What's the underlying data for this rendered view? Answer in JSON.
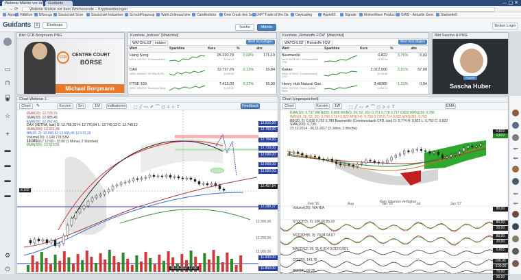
{
  "browser": {
    "tabs": [
      "Webinar Märkte vor dem Wochenende",
      "Guidants"
    ],
    "url": "Webinar Märkte vor dem Wochenende – Kryptowährungen",
    "bookmarks": [
      "Apps",
      "HdbRun",
      "Elfzeugs",
      "Stockchart Scan",
      "Stockchart Industries",
      "SchrottFlopzeug",
      "Wahl-Zeitmaschine",
      "Candlesticks",
      "Dow Crash des Jahrh",
      "24/7 Trade of the Da",
      "Daytrading",
      "Apple60",
      "Signale",
      "MotiveWave Product",
      "GWG - Aktuelle Gesc",
      "Startseite0"
    ]
  },
  "header": {
    "logo": "Guidants",
    "desktop_button": "Desktops",
    "search_button": "Suche",
    "news_button": "Märkte",
    "right_button": "Broker Login"
  },
  "panels": {
    "img1": {
      "title": "Bild CCB Borgmann PNG",
      "logo_line1": "CENTRE COURT",
      "logo_line2": "BÖRSE",
      "logo_abbr": "CCB",
      "person_name": "Michael Borgmann"
    },
    "wl1": {
      "title": "Kursliste „Indizes“ [Watchlist]",
      "tab": "WATCHLIST",
      "tab2": "Indizes",
      "add_button": "Wert hinzufügen",
      "headers": [
        "Wert",
        "Sparkline",
        "Kurs",
        "%",
        "abs"
      ],
      "rows": [
        {
          "name": "Hang Seng",
          "sub": "WKN: 145733 / Commerzbank I",
          "kurs": "25.220,79",
          "pct": "0,68%",
          "abs": "171,10",
          "time": "14:56:13"
        },
        {
          "name": "DAX",
          "sub": "WKN: 846900 / XETRA (EXP)",
          "kurs": "12.727,76",
          "pct": "0,13%",
          "abs": "16,84",
          "time": "14:56:03"
        },
        {
          "name": "FTSE 100",
          "sub": "WKN: 969378 / Deutsche Bank I",
          "kurs": "7.413,00",
          "pct": "0,22%",
          "abs": "16,00",
          "time": "14:55:59"
        }
      ]
    },
    "wl2": {
      "title": "Kursliste „Rohstoffe FCM“ [Watchlist]",
      "tab": "WATCHLIST",
      "tab2": "Rohstoffe FCM",
      "add_button": "Wert hinzufügen",
      "headers": [
        "Wert",
        "Sparkline",
        "Kurs",
        "%",
        "abs"
      ],
      "rows": [
        {
          "name": "Baumwolle",
          "sub": "WKN: A0AEZN / Commerzbank CFD",
          "kurs": "0,822",
          "pct": "3,76%",
          "abs": "0,03",
          "time": "14:56:06"
        },
        {
          "name": "Kakao",
          "sub": "WKN: 970991 / Commerzbank CFD",
          "kurs": "2.012,000",
          "pct": "2,91%",
          "abs": "57,00",
          "time": "14:56:08"
        },
        {
          "name": "Henry Hub Natural Gas",
          "sub": "WKN: 437108 / Forex Capital Mark.",
          "kurs": "3,48360",
          "pct": "1,31%",
          "abs": "0,04",
          "time": "14:56:11"
        }
      ]
    },
    "img2": {
      "title": "Bild Sascha H PNG",
      "badge": "Experte",
      "person_name": "Sascha Huber"
    }
  },
  "chart1": {
    "title": "Chart Webinar 1",
    "toolbar": [
      "Chart",
      "Kerzen",
      "5m",
      "1M",
      "Indikatoren"
    ],
    "feedback_button": "Feedback",
    "legend": [
      {
        "text": "EMA(10): 12.729,76",
        "color": "#d03a3a"
      },
      {
        "text": "SMA(20): 12.685,45",
        "color": "#333333"
      },
      {
        "text": "EMA(20): 12.252,43",
        "color": "#3a6ad0"
      },
      {
        "text": "DAX (XETRA, last)  O: 12.766,32  H: 12.770,94  L: 12.749,12  C: 12.749,12",
        "color": "#111111"
      },
      {
        "text": "SMA(200): 12.221,99",
        "color": "#a03a3a"
      },
      {
        "text": "BB(20, 2): 12.800,62  12.685,45  12.570,28",
        "color": "#3a6ad0"
      },
      {
        "text": "Volume(20): 1.140   778.53M",
        "color": "#333333"
      },
      {
        "text": "13.04.2017  17:00 - 15:00  (1 Monat, 2 Stunden)",
        "color": "#333333"
      },
      {
        "text": "EMA(200): 12.513,56",
        "color": "#3a8a3a"
      }
    ],
    "price_labels": [
      "12.810,00",
      "12.793,00",
      "12.764,00",
      "12.720,00",
      "12.690,00",
      "12.600,00",
      "12.550,00",
      "12.457,84",
      "12.289,37",
      "11.935,00",
      "11.850,00"
    ],
    "axis_labels": [
      "12.300,00",
      "12.250,00",
      "12.000,00"
    ],
    "left_label": "8.160",
    "mid_label": "10.000",
    "date_label": "08.05.2017 17:00"
  },
  "chart2": {
    "title": "Chart [ungespeichert]",
    "toolbar": [
      "Chart",
      "Kerzen",
      "1W",
      "EMA"
    ],
    "legend": [
      {
        "text": "EMA(10): 0,737   WKN(20): 0,808   WKN(9, 26, 52, 26): 0,751  0,778  0,717  0,822  WKN(20): 0,780",
        "color": "#2a8a2a"
      },
      {
        "text": "WKN(9, 26, 52, 26): 0,798  0,714  0,822   ATR(14): 0,750  0,778  0,714  0,822   WKN(20): 0,762",
        "color": "#c07a20"
      },
      {
        "text": "BB(20, 2): 0,816  0,752  0,780   Baumwolle (Commerzbank CFD, last)  O: 0,774  H: 0,822  L: 0,762  C: 0,822",
        "color": "#333333"
      },
      {
        "text": "SMA(200): 0,730",
        "color": "#333333"
      },
      {
        "text": "23.10.2014 - 06.11.2017   (3 Jahre, 1 Woche)",
        "color": "#333333"
      }
    ],
    "x_labels": [
      "Feb '15",
      "Aug",
      "Jan '16",
      "Jul",
      "Jan '17"
    ],
    "price_labels": [
      "0,822",
      "0,822"
    ],
    "sub_panels": [
      {
        "label": "Volume(20): N/A  N/A",
        "right": "80,00"
      },
      {
        "label": "STOCH(5, 3): 100,00  85,19",
        "right": "80,00",
        "right2": "20,00"
      },
      {
        "label": "SSTOCH(5, 3): 79,84  64,07",
        "right": "80,00",
        "right2": "20,00"
      },
      {
        "label": "MACD(12, 26, 9): 0,014  0,012  0,001",
        "right": "0,001"
      },
      {
        "label": "CCI(20): 141,76",
        "right": "100,00",
        "right2": "-100,00"
      },
      {
        "label": "RSI(14): 68,26",
        "right": "70,00",
        "right2": "30,00"
      }
    ],
    "volume_note": "Kein Volumen verfügbar"
  },
  "sidebar_icons": [
    "user-icon",
    "monitor-icon",
    "cart-icon",
    "chat-icon",
    "eye-icon",
    "star-icon",
    "plus-icon",
    "folder-icon",
    "folder-icon",
    "folder-icon",
    "folder-icon",
    "gear-icon",
    "power-icon"
  ],
  "colors": {
    "accent": "#4a7fc0",
    "brand_orange": "#e8782a",
    "green": "#2a8a2a",
    "red": "#d03a3a",
    "navy_label": "#2a3f9a"
  }
}
